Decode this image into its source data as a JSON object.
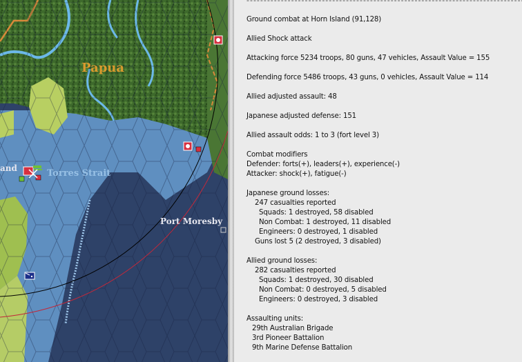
{
  "map": {
    "labels": {
      "papua": "Papua",
      "torres_strait": "Torres Strait",
      "port_moresby": "Port Moresby",
      "island_fragment": "and"
    },
    "colors": {
      "deep_water": "#2e4268",
      "shallow_water": "#5f8fc0",
      "jungle": "#3f6b2a",
      "clear_terrain": "#b8cf62",
      "river": "#6cb8e8",
      "range_circle_black": "#000000",
      "range_circle_red": "#c2283a"
    }
  },
  "report": {
    "separator": "--------------------------------------------------------------------------------------------------",
    "title": "Ground combat at Horn Island (91,128)",
    "attack_type": "Allied Shock attack",
    "attacking_force": "Attacking force 5234 troops, 80 guns, 47 vehicles, Assault Value = 155",
    "defending_force": "Defending force 5486 troops, 43 guns, 0 vehicles, Assault Value = 114",
    "allied_adjusted": "Allied adjusted assault: 48",
    "japanese_adjusted": "Japanese adjusted defense: 151",
    "odds": "Allied assault odds: 1 to 3 (fort level 3)",
    "modifiers_header": "Combat modifiers",
    "defender_mods": "Defender: forts(+), leaders(+), experience(-)",
    "attacker_mods": "Attacker: shock(+), fatigue(-)",
    "japanese_losses": {
      "header": "Japanese ground losses:",
      "casualties": "247 casualties reported",
      "squads": "Squads: 1 destroyed, 58 disabled",
      "non_combat": "Non Combat: 1 destroyed, 11 disabled",
      "engineers": "Engineers: 0 destroyed, 1 disabled",
      "guns": "Guns lost 5 (2 destroyed, 3 disabled)"
    },
    "allied_losses": {
      "header": "Allied ground losses:",
      "casualties": "282 casualties reported",
      "squads": "Squads: 1 destroyed, 30 disabled",
      "non_combat": "Non Combat: 0 destroyed, 5 disabled",
      "engineers": "Engineers: 0 destroyed, 3 disabled"
    },
    "units_header": "Assaulting units:",
    "units": [
      "29th Australian Brigade",
      "3rd Pioneer Battalion",
      "9th Marine Defense Battalion"
    ]
  }
}
